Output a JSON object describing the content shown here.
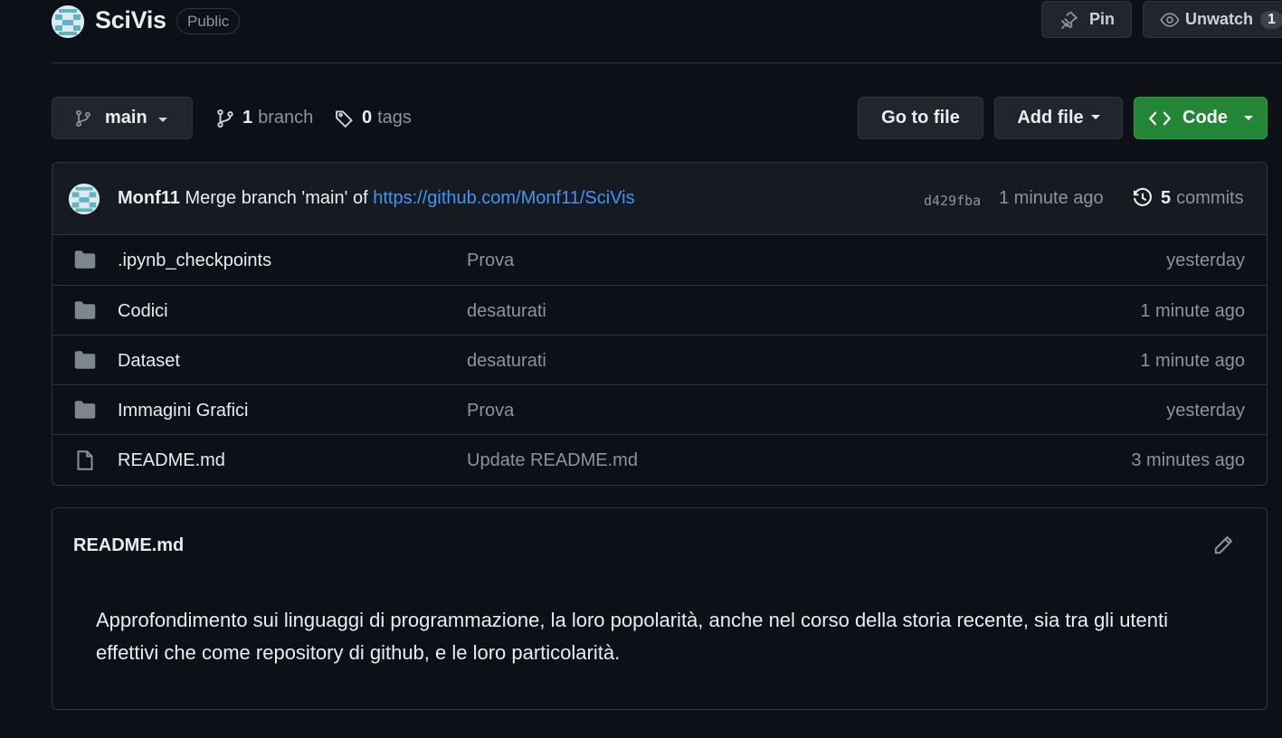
{
  "repo": {
    "name": "SciVis",
    "visibility": "Public",
    "pin_label": "Pin",
    "unwatch_label": "Unwatch",
    "watch_count": "1"
  },
  "toolbar": {
    "branch": "main",
    "branches_count": "1",
    "branches_label": "branch",
    "tags_count": "0",
    "tags_label": "tags",
    "goto_file": "Go to file",
    "add_file": "Add file",
    "code": "Code"
  },
  "commit": {
    "author": "Monf11",
    "message": "Merge branch 'main' of",
    "link": "https://github.com/Monf11/SciVis",
    "sha": "d429fba",
    "age": "1 minute ago",
    "count": "5",
    "count_label": "commits"
  },
  "files": [
    {
      "name": ".ipynb_checkpoints",
      "type": "folder",
      "message": "Prova",
      "age": "yesterday"
    },
    {
      "name": "Codici",
      "type": "folder",
      "message": "desaturati",
      "age": "1 minute ago"
    },
    {
      "name": "Dataset",
      "type": "folder",
      "message": "desaturati",
      "age": "1 minute ago"
    },
    {
      "name": "Immagini Grafici",
      "type": "folder",
      "message": "Prova",
      "age": "yesterday"
    },
    {
      "name": "README.md",
      "type": "file",
      "message": "Update README.md",
      "age": "3 minutes ago"
    }
  ],
  "readme": {
    "title": "README.md",
    "body": "Approfondimento sui linguaggi di programmazione, la loro popolarità, anche nel corso della storia recente, sia tra gli utenti effettivi che come repository di github, e le loro particolarità."
  },
  "colors": {
    "background": "#0d1117",
    "border": "#30363d",
    "code_button": "#238636",
    "link": "#4493f8"
  }
}
